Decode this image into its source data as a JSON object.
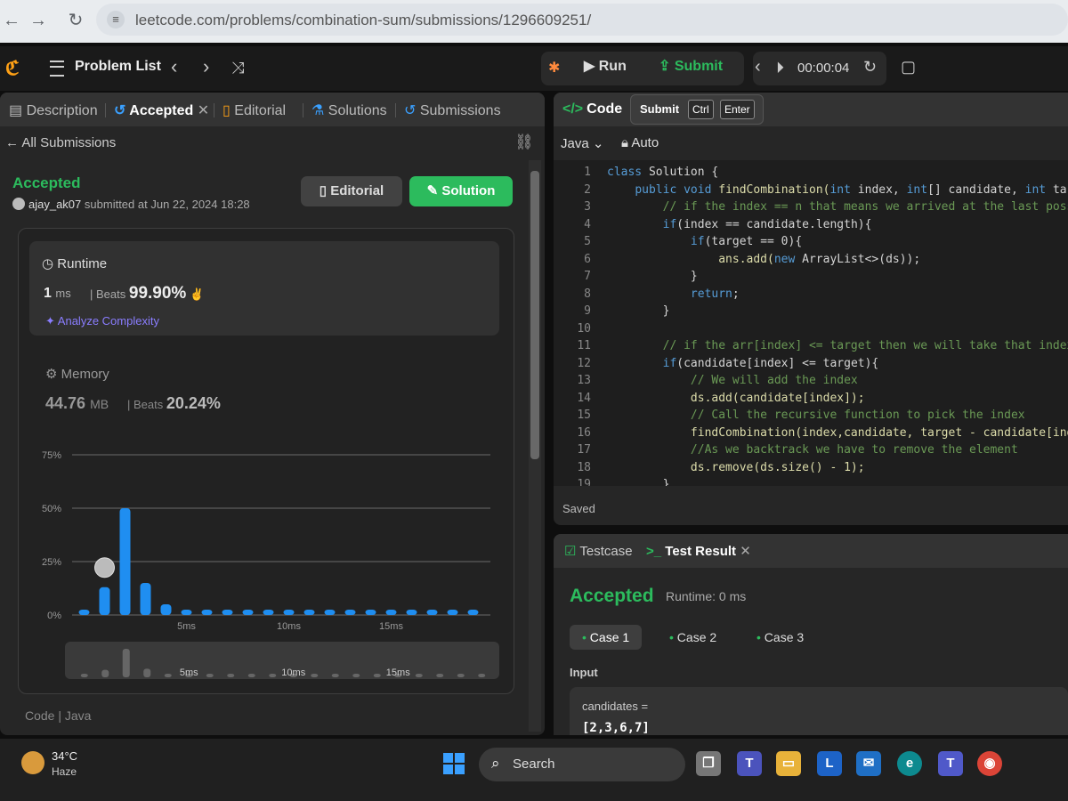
{
  "browser": {
    "url": "leetcode.com/problems/combination-sum/submissions/1296609251/"
  },
  "nav": {
    "problem_list": "Problem List",
    "run": "Run",
    "submit": "Submit",
    "timer": "00:00:04"
  },
  "left": {
    "tabs": [
      "Description",
      "Accepted",
      "Editorial",
      "Solutions",
      "Submissions"
    ],
    "back": "All Submissions",
    "status": "Accepted",
    "username": "ajay_ak07",
    "submitted_text": "submitted at Jun 22, 2024 18:28",
    "editorial_btn": "Editorial",
    "solution_btn": "Solution",
    "runtime": {
      "label": "Runtime",
      "value": "1",
      "unit": "ms",
      "beats_label": "Beats",
      "beats": "99.90%",
      "analyze": "Analyze Complexity"
    },
    "memory": {
      "label": "Memory",
      "value": "44.76",
      "unit": "MB",
      "beats_label": "Beats",
      "beats": "20.24%"
    },
    "code_lang": "Code | Java"
  },
  "chart_data": {
    "type": "bar",
    "y_ticks": [
      "75%",
      "50%",
      "25%",
      "0%"
    ],
    "ylim": [
      0,
      75
    ],
    "x_ticks": [
      "5ms",
      "10ms",
      "15ms"
    ],
    "categories": [
      "0ms",
      "1ms",
      "2ms",
      "3ms",
      "4ms",
      "5ms",
      "6ms",
      "7ms",
      "8ms",
      "9ms",
      "10ms",
      "11ms",
      "12ms",
      "13ms",
      "14ms",
      "15ms",
      "16ms",
      "17ms",
      "18ms",
      "19ms"
    ],
    "values": [
      1,
      13,
      50,
      15,
      5,
      1,
      1,
      1,
      1,
      1,
      1,
      1,
      1,
      1,
      1,
      1,
      1,
      1,
      1,
      1
    ],
    "highlight_index": 1,
    "mini_x_ticks": [
      "5ms",
      "10ms",
      "15ms"
    ],
    "colors": {
      "bar": "#1f8ef1",
      "grid": "#6b6b6b"
    }
  },
  "code_panel": {
    "tab": "Code",
    "tooltip_label": "Submit",
    "tooltip_keys": [
      "Ctrl",
      "Enter"
    ],
    "language": "Java",
    "mode": "Auto",
    "saved": "Saved",
    "lines": [
      "class Solution {",
      "    public void findCombination(int index, int[] candidate, int tar",
      "        // if the index == n that means we arrived at the last poss",
      "        if(index == candidate.length){",
      "            if(target == 0){",
      "                ans.add(new ArrayList<>(ds));",
      "            }",
      "            return;",
      "        }",
      "",
      "        // if the arr[index] <= target then we will take that index",
      "        if(candidate[index] <= target){",
      "            // We will add the index",
      "            ds.add(candidate[index]);",
      "            // Call the recursive function to pick the index",
      "            findCombination(index,candidate, target - candidate[inde",
      "            //As we backtrack we have to remove the element",
      "            ds.remove(ds.size() - 1);",
      "        }"
    ]
  },
  "result": {
    "testcase_tab": "Testcase",
    "testresult_tab": "Test Result",
    "status": "Accepted",
    "runtime": "Runtime: 0 ms",
    "cases": [
      "Case 1",
      "Case 2",
      "Case 3"
    ],
    "input_label": "Input",
    "param_name": "candidates =",
    "param_value": "[2,3,6,7]"
  },
  "taskbar": {
    "temp": "34°C",
    "weather": "Haze",
    "search": "Search"
  }
}
